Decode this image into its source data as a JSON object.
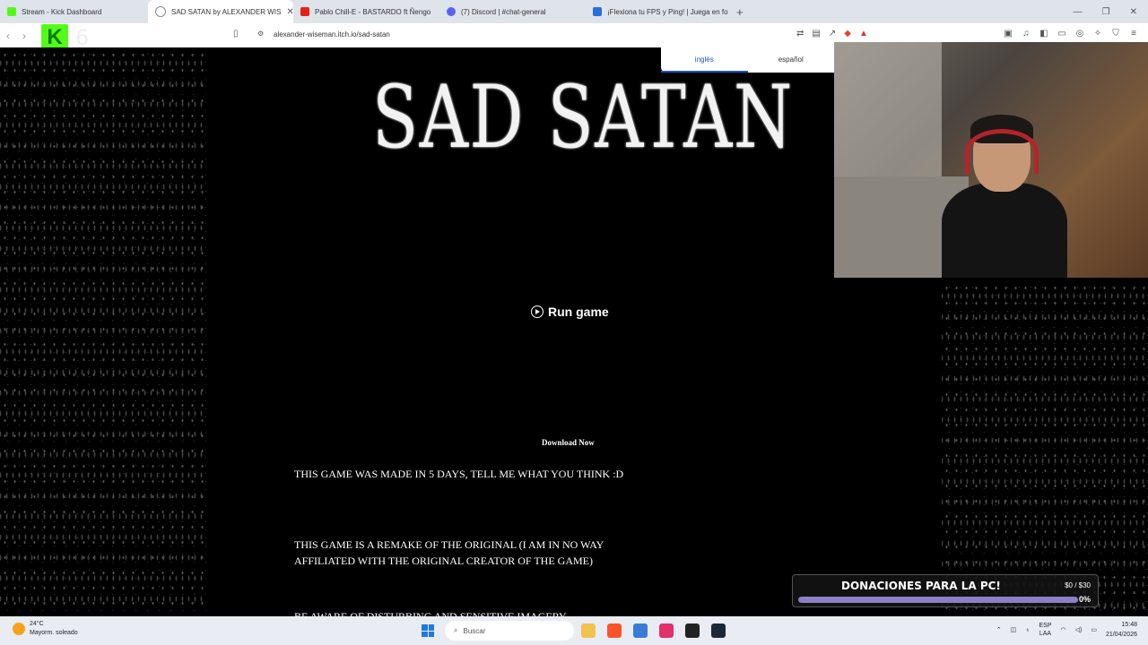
{
  "browser": {
    "tabs": [
      {
        "title": "Stream - Kick Dashboard",
        "color": "#53fc18"
      },
      {
        "title": "SAD SATAN by ALEXANDER WIS",
        "color": "#888888"
      },
      {
        "title": "Pablo Chill-E - BASTARDO ft Ñengo",
        "color": "#e62117"
      },
      {
        "title": "(7) Discord | #chat-general",
        "color": "#5865f2"
      },
      {
        "title": "¡Flexiona tu FPS y Ping! | Juega en fo",
        "color": "#2a6fdb"
      }
    ],
    "new_tab": "+",
    "url": "alexander-wiseman.itch.io/sad-satan"
  },
  "kick_overlay": {
    "logo": "K",
    "count": "6"
  },
  "translate": {
    "lang_from": "inglés",
    "lang_to": "español"
  },
  "game": {
    "title": "SAD SATAN",
    "run_label": "Run game",
    "download_label": "Download Now",
    "paragraphs": [
      "THIS GAME WAS MADE IN 5 DAYS, TELL ME WHAT YOU THINK :D",
      "THIS GAME IS A REMAKE OF THE ORIGINAL (I AM IN NO WAY AFFILIATED WITH THE ORIGINAL CREATOR OF THE GAME)",
      "BE AWARE OF DISTURBING AND SENSITIVE IMAGERY"
    ]
  },
  "donation": {
    "title": "DONACIONES PARA LA PC!",
    "amount": "$0 / $30",
    "percent": "0%"
  },
  "taskbar": {
    "temperature": "24°C",
    "weather": "Mayorm. soleado",
    "search_placeholder": "Buscar",
    "lang_top": "ESP",
    "lang_bottom": "LAA",
    "time": "15:48",
    "date": "21/04/2026"
  }
}
